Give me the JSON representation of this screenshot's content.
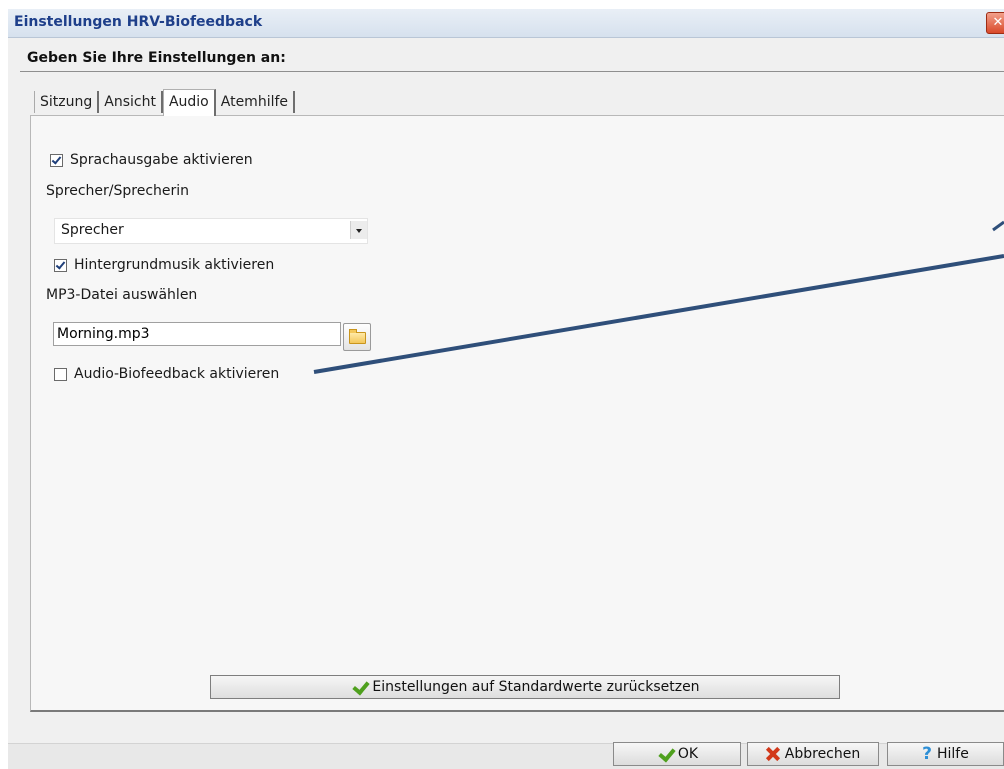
{
  "window": {
    "title": "Einstellungen HRV-Biofeedback",
    "close_glyph": "✕"
  },
  "heading": "Geben Sie Ihre Einstellungen an:",
  "tabs": [
    {
      "label": "Sitzung",
      "active": false
    },
    {
      "label": "Ansicht",
      "active": false
    },
    {
      "label": "Audio",
      "active": true
    },
    {
      "label": "Atemhilfe",
      "active": false
    }
  ],
  "audio": {
    "speech_output": {
      "label": "Sprachausgabe aktivieren",
      "checked": true
    },
    "speaker_label": "Sprecher/Sprecherin",
    "speaker_select": {
      "value": "Sprecher"
    },
    "background_music": {
      "label": "Hintergrundmusik aktivieren",
      "checked": true
    },
    "mp3_label": "MP3-Datei auswählen",
    "mp3_file": {
      "value": "Morning.mp3"
    },
    "audio_biofeedback": {
      "label": "Audio-Biofeedback aktivieren",
      "checked": false
    }
  },
  "reset_button": {
    "label": "Einstellungen auf Standardwerte zurücksetzen"
  },
  "footer": {
    "ok_label": "OK",
    "cancel_label": "Abbrechen",
    "help_label": "Hilfe"
  },
  "colors": {
    "title_text": "#1e3f8a",
    "annotation_line": "#2f4f7a",
    "check_green": "#4fa01e",
    "cancel_red": "#d2381a",
    "help_blue": "#2d8fd6"
  },
  "icons": [
    "close-icon",
    "folder-icon",
    "checkmark-icon",
    "cancel-x-icon",
    "help-question-icon"
  ]
}
